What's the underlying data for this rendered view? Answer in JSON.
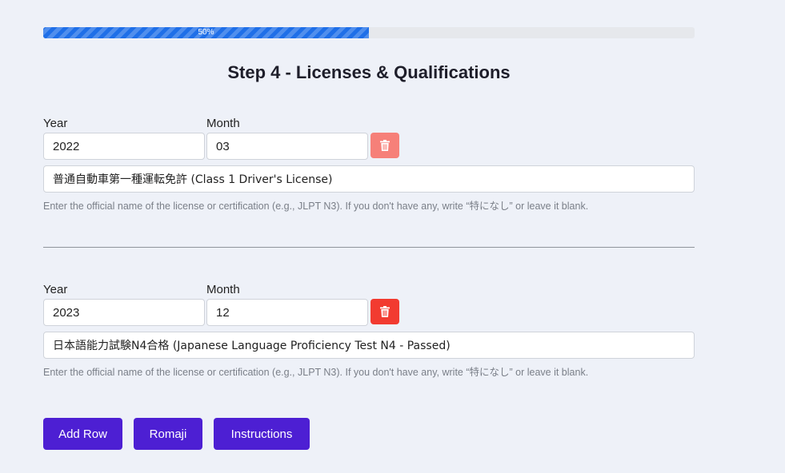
{
  "progress": {
    "percent": 50,
    "label": "50%"
  },
  "title": "Step 4 - Licenses & Qualifications",
  "labels": {
    "year": "Year",
    "month": "Month"
  },
  "hint": "Enter the official name of the license or certification (e.g., JLPT N3). If you don't have any, write “特になし” or leave it blank.",
  "entries": [
    {
      "year": "2022",
      "month": "03",
      "name": "普通自動車第一種運転免許 (Class 1 Driver's License)",
      "delete_icon": "trash-icon"
    },
    {
      "year": "2023",
      "month": "12",
      "name": "日本語能力試験N4合格 (Japanese Language Proficiency Test N4 - Passed)",
      "delete_icon": "trash-icon"
    }
  ],
  "buttons": {
    "add_row": "Add Row",
    "romaji": "Romaji",
    "instructions": "Instructions"
  },
  "colors": {
    "progress": "#1f6fe8",
    "primary_button": "#4d1fd3",
    "delete_button_light": "#f68079",
    "delete_button": "#f23b30",
    "background": "#eef1f8"
  }
}
